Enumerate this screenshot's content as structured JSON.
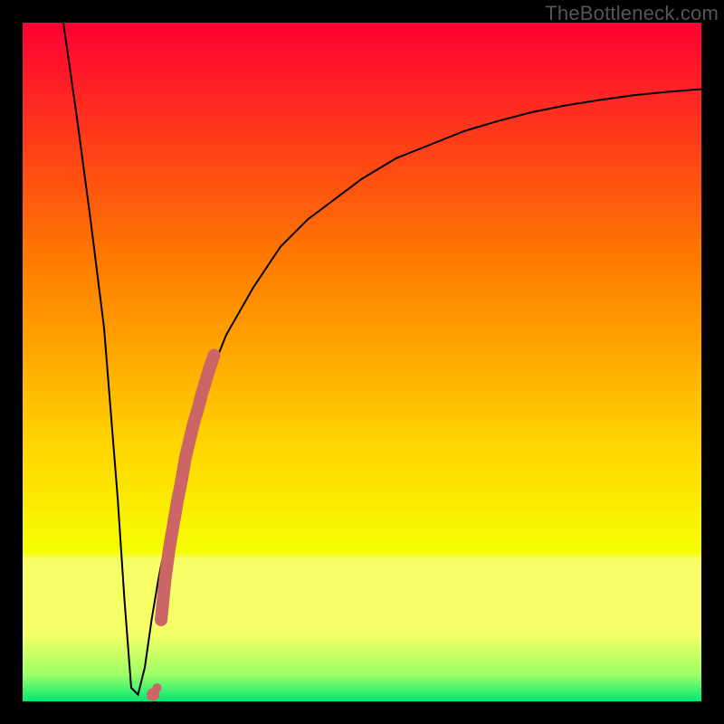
{
  "watermark": "TheBottleneck.com",
  "colors": {
    "frame": "#000000",
    "curve": "#000000",
    "marker": "#cc6666",
    "grad_top": "#ff0033",
    "grad_mid1": "#ff7a00",
    "grad_mid2": "#ffd400",
    "grad_band": "#f7ff66",
    "grad_bottom": "#00e874"
  },
  "chart_data": {
    "type": "line",
    "title": "",
    "xlabel": "",
    "ylabel": "",
    "xlim": [
      0,
      100
    ],
    "ylim": [
      0,
      100
    ],
    "note": "y is plotted downward from top; curve dips to ~0 at x≈16 then rises asymptotically toward ~90.",
    "series": [
      {
        "name": "bottleneck-curve",
        "x": [
          6,
          8,
          10,
          12,
          14,
          15,
          16,
          17,
          18,
          19,
          20,
          22,
          24,
          26,
          28,
          30,
          34,
          38,
          42,
          46,
          50,
          55,
          60,
          65,
          70,
          75,
          80,
          85,
          90,
          95,
          100
        ],
        "y": [
          100,
          86,
          71,
          55,
          30,
          15,
          2,
          1,
          5,
          12,
          18,
          28,
          36,
          43,
          49,
          54,
          61,
          67,
          71,
          74,
          77,
          80,
          82,
          84,
          85.5,
          86.8,
          87.8,
          88.6,
          89.3,
          89.8,
          90.2
        ]
      }
    ],
    "markers": {
      "name": "highlight-segment",
      "x": [
        19.2,
        19.8,
        20.4,
        21.0,
        21.6,
        22.2,
        22.8,
        23.4,
        24.0,
        24.6,
        25.2,
        25.8,
        26.4,
        27.0,
        27.6,
        28.2
      ],
      "y": [
        1.0,
        2.0,
        12.0,
        18.0,
        22.5,
        26.0,
        29.5,
        32.5,
        36.0,
        38.5,
        41.0,
        43.0,
        45.3,
        47.3,
        49.3,
        51.0
      ]
    }
  }
}
